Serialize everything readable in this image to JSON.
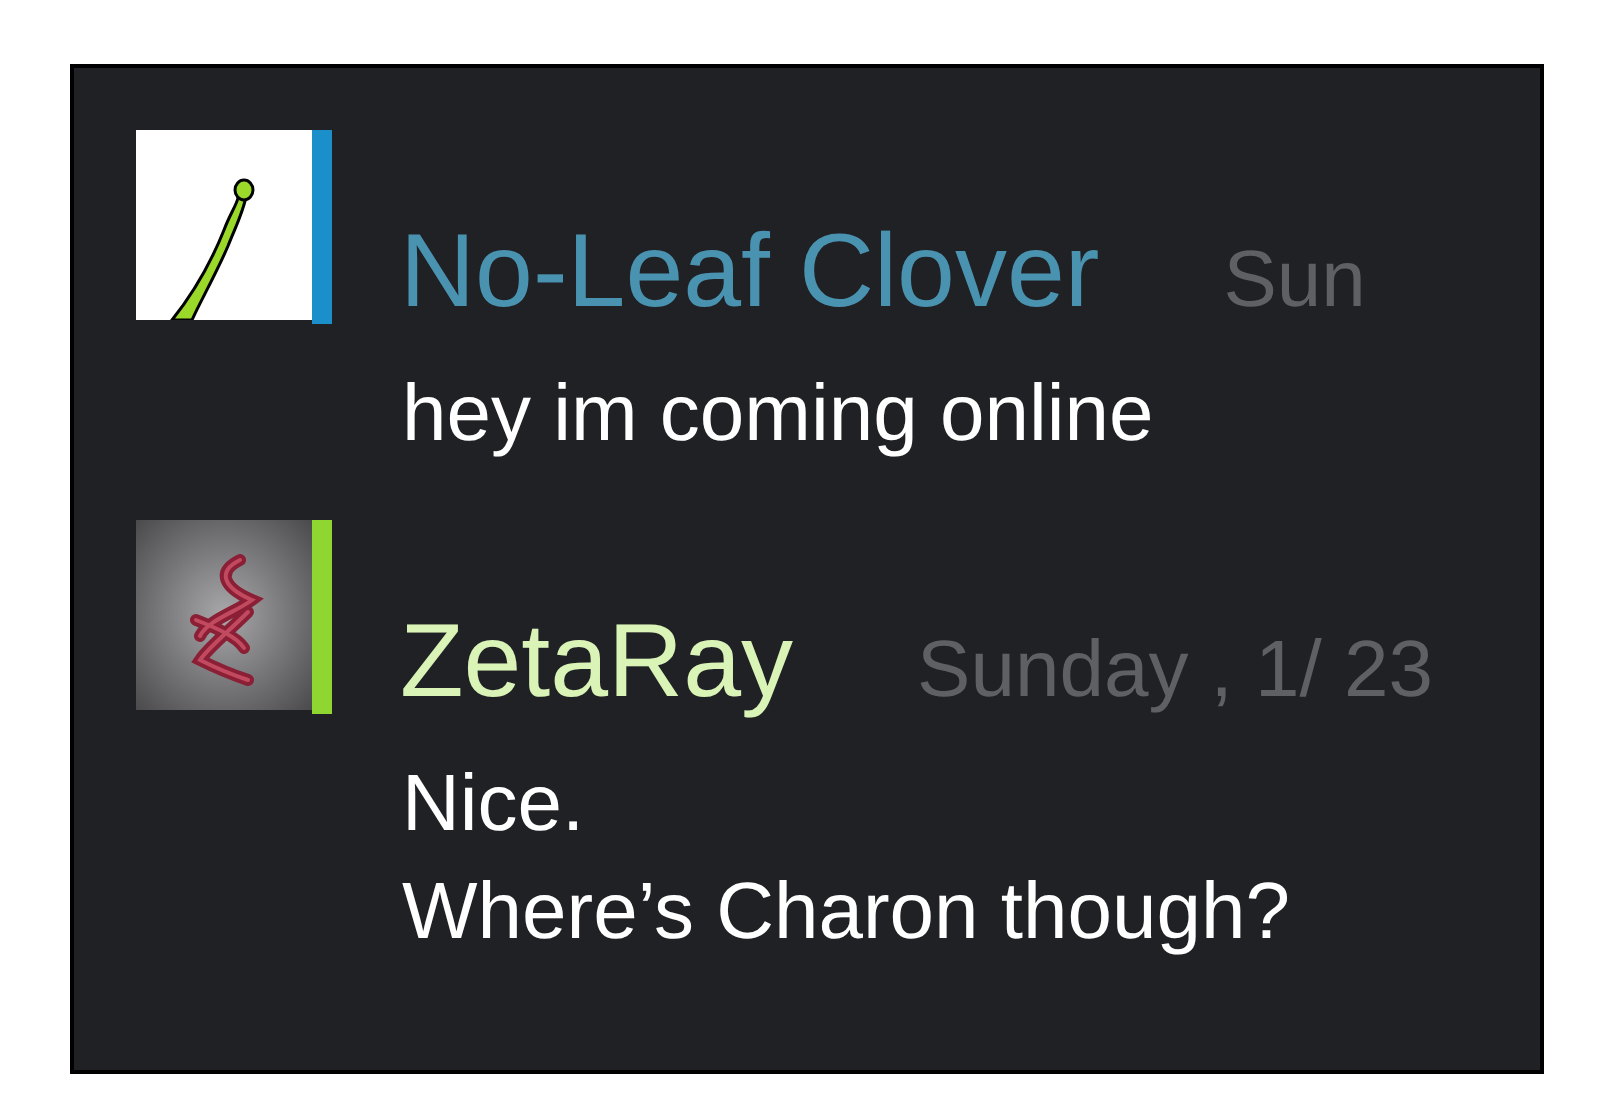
{
  "messages": [
    {
      "name": {
        "text": "No-Leaf Clover",
        "color": "#4a93b0"
      },
      "color": "#1a8fc9",
      "avatar": {
        "kind": "sprout"
      },
      "time": "Sun",
      "lines": [
        "hey im coming online"
      ]
    },
    {
      "name": {
        "text": "ZetaRay",
        "color": "#d9f4b6"
      },
      "color": "#8fd630",
      "avatar": {
        "kind": "squiggle"
      },
      "time": "Sunday , 1/ 23",
      "lines": [
        "Nice.",
        "Where’s Charon though?"
      ]
    }
  ]
}
